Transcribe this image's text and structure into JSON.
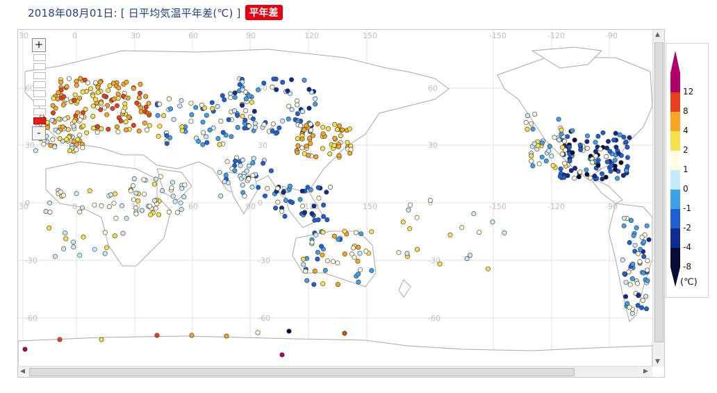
{
  "header": {
    "title": "2018年08月01日: [ 日平均気温平年差(℃) ]",
    "badge": "平年差"
  },
  "map": {
    "lon_labels": [
      "30",
      "0",
      "30",
      "60",
      "90",
      "120",
      "150",
      "-150",
      "-120",
      "-90"
    ],
    "lat_labels": [
      "60",
      "30",
      "0",
      "-30",
      "-60"
    ],
    "zoom": {
      "plus": "+",
      "minus": "-"
    }
  },
  "legend": {
    "labels": [
      "12",
      "8",
      "4",
      "2",
      "1",
      "0",
      "-1",
      "-2",
      "-4",
      "-8"
    ],
    "unit": "(℃)",
    "colors": [
      "#b0006a",
      "#e8401c",
      "#f5a623",
      "#f7e14a",
      "#fffde0",
      "#c6eafb",
      "#3fa0e8",
      "#1f5fd6",
      "#102c94",
      "#060c33"
    ]
  }
}
